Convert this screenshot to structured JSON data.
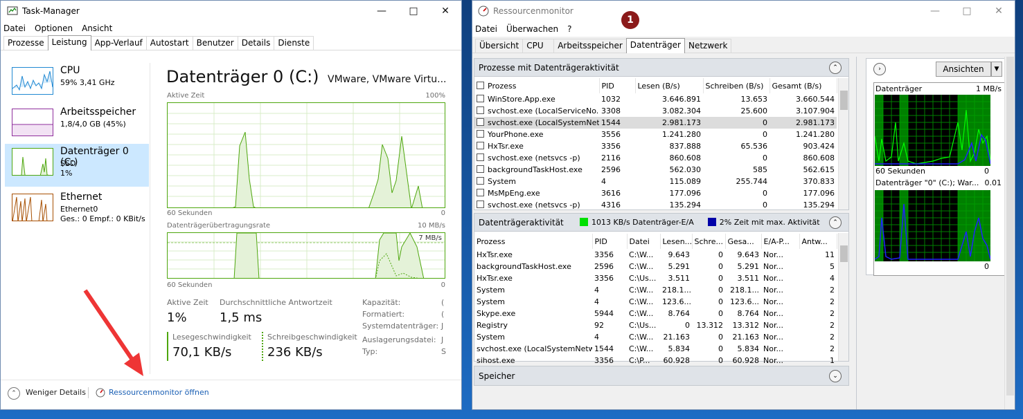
{
  "taskmanager": {
    "title": "Task-Manager",
    "menu": [
      "Datei",
      "Optionen",
      "Ansicht"
    ],
    "tabs": [
      "Prozesse",
      "Leistung",
      "App-Verlauf",
      "Autostart",
      "Benutzer",
      "Details",
      "Dienste"
    ],
    "selected_tab": "Leistung",
    "sidebar": [
      {
        "name": "CPU",
        "line1": "59% 3,41 GHz",
        "line2": "",
        "color": "#1f88d2"
      },
      {
        "name": "Arbeitsspeicher",
        "line1": "1,8/4,0 GB (45%)",
        "line2": "",
        "color": "#8e2d9c"
      },
      {
        "name": "Datenträger 0 (C:)",
        "line1": "SSD",
        "line2": "1%",
        "color": "#4da60c"
      },
      {
        "name": "Ethernet",
        "line1": "Ethernet0",
        "line2": "Ges.: 0 Empf.: 0 KBit/s",
        "color": "#a74f01"
      }
    ],
    "main": {
      "title": "Datenträger 0 (C:)",
      "model": "VMware, VMware Virtu...",
      "graph1_label": "Aktive Zeit",
      "graph1_max": "100%",
      "graph1_xleft": "60 Sekunden",
      "graph1_xright": "0",
      "graph2_label": "Datenträgerübertragungsrate",
      "graph2_max": "10 MB/s",
      "graph2_inner": "7 MB/s",
      "graph2_xleft": "60 Sekunden",
      "graph2_xright": "0",
      "active_time_label": "Aktive Zeit",
      "active_time_value": "1%",
      "response_label": "Durchschnittliche Antwortzeit",
      "response_value": "1,5 ms",
      "read_label": "Lesegeschwindigkeit",
      "read_value": "70,1 KB/s",
      "write_label": "Schreibgeschwindigkeit",
      "write_value": "236 KB/s",
      "kv": [
        {
          "key": "Kapazität:",
          "value": "("
        },
        {
          "key": "Formatiert:",
          "value": "("
        },
        {
          "key": "Systemdatenträger:",
          "value": "J"
        },
        {
          "key": "Auslagerungsdatei:",
          "value": "J"
        },
        {
          "key": "Typ:",
          "value": "S"
        }
      ]
    },
    "footer": {
      "less_details": "Weniger Details",
      "open_resmon": "Ressourcenmonitor öffnen"
    }
  },
  "resmon": {
    "title": "Ressourcenmonitor",
    "badge": "1",
    "menu": [
      "Datei",
      "Überwachen",
      "?"
    ],
    "tabs": [
      "Übersicht",
      "CPU",
      "Arbeitsspeicher",
      "Datenträger",
      "Netzwerk"
    ],
    "selected_tab": "Datenträger",
    "proc_panel": {
      "title": "Prozesse mit Datenträgeraktivität",
      "columns": [
        "Prozess",
        "PID",
        "Lesen (B/s)",
        "Schreiben (B/s)",
        "Gesamt (B/s)"
      ],
      "rows": [
        [
          "WinStore.App.exe",
          "1032",
          "3.646.891",
          "13.653",
          "3.660.544"
        ],
        [
          "svchost.exe (LocalServiceNo...",
          "3308",
          "3.082.304",
          "25.600",
          "3.107.904"
        ],
        [
          "svchost.exe (LocalSystemNet...",
          "1544",
          "2.981.173",
          "0",
          "2.981.173"
        ],
        [
          "YourPhone.exe",
          "3556",
          "1.241.280",
          "0",
          "1.241.280"
        ],
        [
          "HxTsr.exe",
          "3356",
          "837.888",
          "65.536",
          "903.424"
        ],
        [
          "svchost.exe (netsvcs -p)",
          "2116",
          "860.608",
          "0",
          "860.608"
        ],
        [
          "backgroundTaskHost.exe",
          "2596",
          "562.030",
          "585",
          "562.615"
        ],
        [
          "System",
          "4",
          "115.089",
          "255.744",
          "370.833"
        ],
        [
          "MsMpEng.exe",
          "3616",
          "177.096",
          "0",
          "177.096"
        ],
        [
          "svchost.exe (netsvcs -p)",
          "4316",
          "135.294",
          "0",
          "135.294"
        ]
      ]
    },
    "disk_panel": {
      "title": "Datenträgeraktivität",
      "legend1": "1013 KB/s Datenträger-E/A",
      "legend1_color": "#00e000",
      "legend2": "2% Zeit mit max. Aktivität",
      "legend2_color": "#0000a8",
      "columns": [
        "Prozess",
        "PID",
        "Datei",
        "Lesen...",
        "Schre...",
        "Gesa...",
        "E/A-P...",
        "Antw..."
      ],
      "rows": [
        [
          "HxTsr.exe",
          "3356",
          "C:\\W...",
          "9.643",
          "0",
          "9.643",
          "Nor...",
          "11"
        ],
        [
          "backgroundTaskHost.exe",
          "2596",
          "C:\\W...",
          "5.291",
          "0",
          "5.291",
          "Nor...",
          "5"
        ],
        [
          "HxTsr.exe",
          "3356",
          "C:\\Us...",
          "3.511",
          "0",
          "3.511",
          "Nor...",
          "4"
        ],
        [
          "System",
          "4",
          "C:\\W...",
          "218.1...",
          "0",
          "218.1...",
          "Nor...",
          "2"
        ],
        [
          "System",
          "4",
          "C:\\W...",
          "123.6...",
          "0",
          "123.6...",
          "Nor...",
          "2"
        ],
        [
          "Skype.exe",
          "5944",
          "C:\\W...",
          "8.764",
          "0",
          "8.764",
          "Nor...",
          "2"
        ],
        [
          "Registry",
          "92",
          "C:\\Us...",
          "0",
          "13.312",
          "13.312",
          "Nor...",
          "2"
        ],
        [
          "System",
          "4",
          "C:\\W...",
          "21.163",
          "0",
          "21.163",
          "Nor...",
          "2"
        ],
        [
          "svchost.exe (LocalSystemNetw...",
          "1544",
          "C:\\W...",
          "5.834",
          "0",
          "5.834",
          "Nor...",
          "2"
        ],
        [
          "sihost.exe",
          "3356",
          "C:\\P...",
          "60.928",
          "0",
          "60.928",
          "Nor...",
          "1"
        ]
      ]
    },
    "storage_panel": {
      "title": "Speicher"
    },
    "graphs": {
      "view_button": "Ansichten",
      "g1_title": "Datenträger",
      "g1_max": "1 MB/s",
      "g1_xleft": "60 Sekunden",
      "g1_xright": "0",
      "g2_title": "Datenträger \"0\" (C:); War...",
      "g2_max": "0.01",
      "g2_xright": "0"
    }
  }
}
